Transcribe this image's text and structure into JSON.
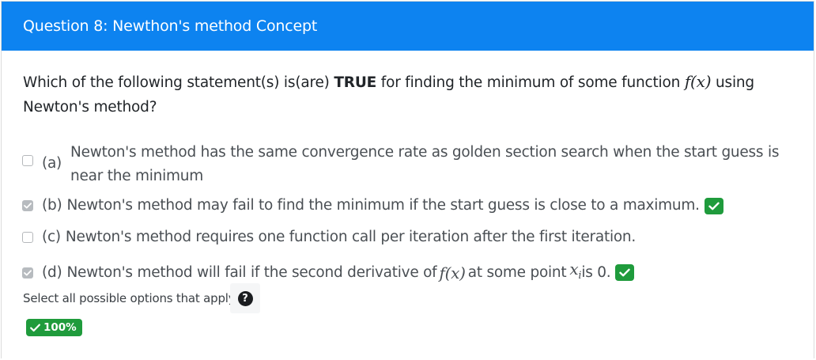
{
  "header": {
    "title": "Question 8: Newthon's method Concept",
    "background_color": "#0d83f0"
  },
  "question": {
    "before_bold": "Which of the following statement(s) is(are) ",
    "bold": "TRUE",
    "middle": " for finding the minimum of some function ",
    "math_func": "f(x)",
    "after_math": " using Newton's method?"
  },
  "options": [
    {
      "letter": "(a)",
      "text": "Newton's method has the same convergence rate as golden section search when the start guess is near the minimum",
      "checked": false,
      "correct_mark": false
    },
    {
      "letter": "(b)",
      "text": "Newton's method may fail to find the minimum if the start guess is close to a maximum.",
      "checked": true,
      "correct_mark": true
    },
    {
      "letter": "(c)",
      "text": "Newton's method requires one function call per iteration after the first iteration.",
      "checked": false,
      "correct_mark": false
    },
    {
      "letter": "(d)",
      "text_before": "Newton's method will fail if the second derivative of ",
      "math_func": "f(x)",
      "text_middle": " at some point ",
      "math_point": "x",
      "math_sub": "i",
      "text_after": " is 0.",
      "checked": true,
      "correct_mark": true
    }
  ],
  "hint": "Select all possible options that apply.",
  "help_icon": "question-circle-icon",
  "score": {
    "label": "100%",
    "icon": "check-icon",
    "color": "#1f9b3c"
  }
}
